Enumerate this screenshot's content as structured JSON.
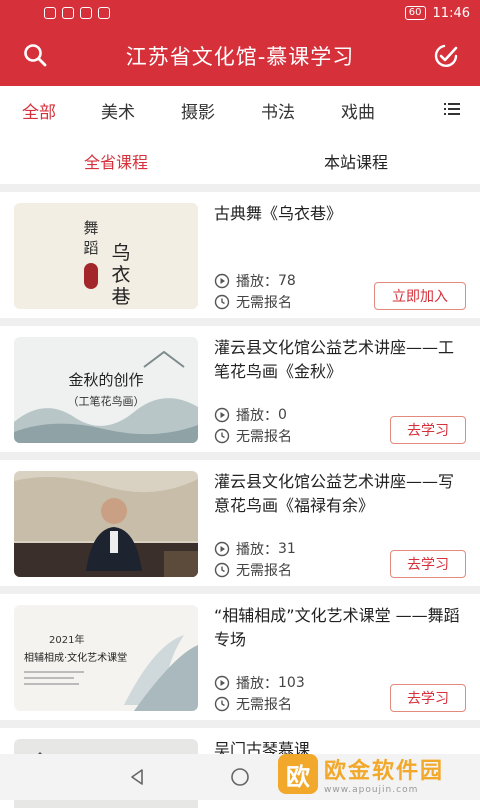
{
  "status_bar": {
    "battery": "60",
    "time": "11:46"
  },
  "header": {
    "title": "江苏省文化馆-慕课学习",
    "left_icon": "search-icon",
    "right_icon": "edit-check-icon"
  },
  "categories": [
    {
      "label": "全部",
      "active": true
    },
    {
      "label": "美术",
      "active": false
    },
    {
      "label": "摄影",
      "active": false
    },
    {
      "label": "书法",
      "active": false
    },
    {
      "label": "戏曲",
      "active": false
    }
  ],
  "scopes": [
    {
      "label": "全省课程",
      "active": true
    },
    {
      "label": "本站课程",
      "active": false
    }
  ],
  "courses": [
    {
      "title": "古典舞《乌衣巷》",
      "play_label": "播放：",
      "plays": "78",
      "enroll": "无需报名",
      "button": "立即加入",
      "thumb_text": {
        "v1": "舞蹈",
        "v2": "乌衣巷"
      }
    },
    {
      "title": "灌云县文化馆公益艺术讲座——工笔花鸟画《金秋》",
      "play_label": "播放：",
      "plays": "0",
      "enroll": "无需报名",
      "button": "去学习",
      "thumb_text": {
        "line1": "金秋的创作",
        "line2": "（工笔花鸟画）"
      }
    },
    {
      "title": "灌云县文化馆公益艺术讲座——写意花鸟画《福禄有余》",
      "play_label": "播放：",
      "plays": "31",
      "enroll": "无需报名",
      "button": "去学习",
      "thumb_text": {}
    },
    {
      "title": "“相辅相成”文化艺术课堂 ——舞蹈专场",
      "play_label": "播放：",
      "plays": "103",
      "enroll": "无需报名",
      "button": "去学习",
      "thumb_text": {
        "line1": "2021年",
        "line2": "相辅相成·文化艺术课堂"
      }
    },
    {
      "title": "吴门古琴慕课"
    }
  ],
  "watermark": {
    "logo": "欧",
    "main": "欧金软件园",
    "sub": "www.apoujin.com"
  },
  "colors": {
    "brand": "#d6303a",
    "accent_btn_border": "#e28a7e"
  }
}
